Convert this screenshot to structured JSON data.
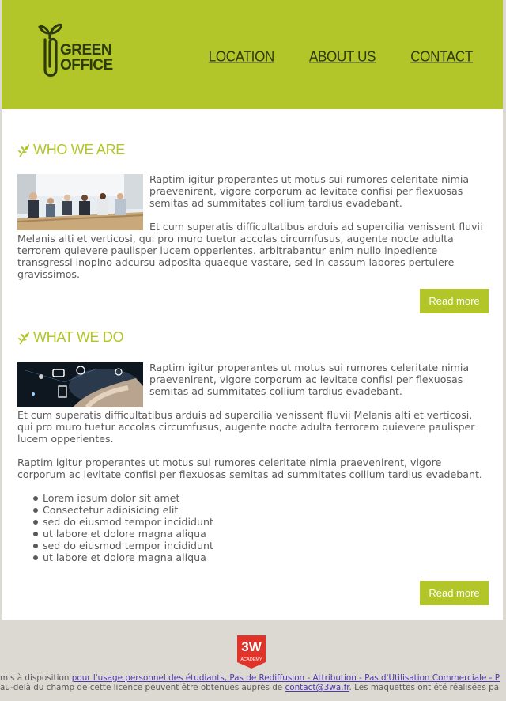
{
  "brand": {
    "line1": "GREEN",
    "line2": "OFFICE",
    "accent_color": "#b2c629"
  },
  "nav": {
    "items": [
      {
        "label": "LOCATION"
      },
      {
        "label": "ABOUT US"
      },
      {
        "label": "CONTACT"
      }
    ]
  },
  "who": {
    "title": "WHO WE ARE",
    "icon": "leaf-icon",
    "image": "meeting-photo",
    "para1": "Raptim igitur properantes ut motus sui rumores celeritate nimia praevenirent, vigore corporum ac levitate confisi per flexuosas semitas ad summitates collium tardius evadebant.",
    "para2": "Et cum superatis difficultatibus arduis ad supercilia venissent fluvii Melanis alti et verticosi, qui pro muro tuetur accolas circumfusus, augente nocte adulta terrorem quievere paulisper lucem opperientes. arbitrabantur enim nullo inpediente transgressi inopino adcursu adposita quaeque vastare, sed in cassum labores pertulere gravissimos.",
    "button": "Read more"
  },
  "what": {
    "title": "WHAT WE DO",
    "icon": "leaf-icon",
    "image": "touchscreen-photo",
    "para1": "Raptim igitur properantes ut motus sui rumores celeritate nimia praevenirent, vigore corporum ac levitate confisi per flexuosas semitas ad summitates collium tardius evadebant.",
    "para2": "Et cum superatis difficultatibus arduis ad supercilia venissent fluvii Melanis alti et verticosi, qui pro muro tuetur accolas circumfusus, augente nocte adulta terrorem quievere paulisper lucem opperientes.",
    "para3": "Raptim igitur properantes ut motus sui rumores celeritate nimia praevenirent, vigore corporum ac levitate confisi per flexuosas semitas ad summitates collium tardius evadebant.",
    "list": [
      "Lorem ipsum dolor sit amet",
      "Consectetur adipisicing elit",
      "sed do eiusmod tempor incididunt",
      "ut labore et dolore magna aliqua",
      "sed do eiusmod tempor incididunt",
      "ut labore et dolore magna aliqua"
    ],
    "button": "Read more"
  },
  "footer": {
    "badge_text": "3W",
    "badge_sub": "ACADEMY",
    "line1_prefix": "mis à disposition ",
    "line1_link": "pour l'usage personnel des étudiants, Pas de Rediffusion - Attribution - Pas d'Utilisation Commerciale - P",
    "line2_prefix": " au-delà du champ de cette licence peuvent être obtenues auprès de ",
    "line2_link": "contact@3wa.fr",
    "line2_suffix": ". Les maquettes ont été réalisées pa"
  }
}
